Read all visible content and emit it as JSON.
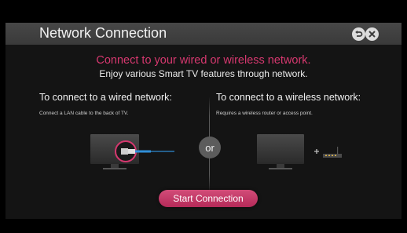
{
  "header": {
    "title": "Network Connection",
    "back_icon": "back-arrow-icon",
    "close_icon": "close-icon"
  },
  "intro": {
    "headline": "Connect to your wired or wireless network.",
    "subline": "Enjoy various Smart TV features through network."
  },
  "wired": {
    "title": "To connect to a wired network:",
    "description": "Connect a LAN cable to the back of TV."
  },
  "wireless": {
    "title": "To connect to a wireless network:",
    "description": "Requires a wireless router or access point."
  },
  "separator_label": "or",
  "actions": {
    "start_label": "Start Connection"
  },
  "colors": {
    "accent": "#d6386f",
    "header": "#3f3f3f",
    "background": "#141414",
    "cable": "#2f8fd8"
  }
}
